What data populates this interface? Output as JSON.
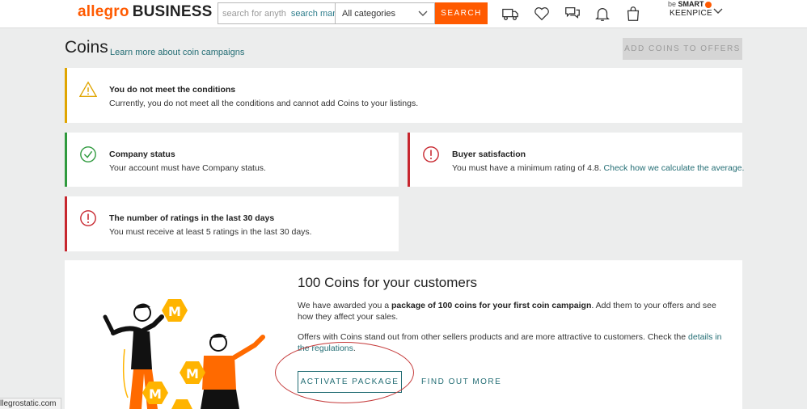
{
  "header": {
    "logo_brand": "allegro",
    "logo_suffix": "BUSINESS",
    "search_placeholder": "search for anyth",
    "search_hint": "search many",
    "category": "All categories",
    "search_button": "SEARCH",
    "account_program_prefix": "be",
    "account_program": "SMART",
    "account_name": "KEENPICE"
  },
  "page": {
    "title": "Coins",
    "learn_link": "Learn more about coin campaigns",
    "add_coins_button": "ADD COINS TO OFFERS"
  },
  "alerts": {
    "warning": {
      "title": "You do not meet the conditions",
      "text": "Currently, you do not meet all the conditions and cannot add Coins to your listings."
    },
    "company": {
      "title": "Company status",
      "text": "Your account must have Company status."
    },
    "buyer": {
      "title": "Buyer satisfaction",
      "text": "You must have a minimum rating of 4.8.",
      "link": "Check how we calculate the average."
    },
    "ratings": {
      "title": "The number of ratings in the last 30 days",
      "text": "You must receive at least 5 ratings in the last 30 days."
    }
  },
  "promo": {
    "title": "100 Coins for your customers",
    "p1_pre": "We have awarded you a ",
    "p1_bold": "package of 100 coins for your first coin campaign",
    "p1_post": ". Add them to your offers and see how they affect your sales.",
    "p2_pre": "Offers with Coins stand out from other sellers products and are more attractive to customers. Check the ",
    "p2_link": "details in the regulations",
    "p2_post": ".",
    "activate_button": "ACTIVATE PACKAGE",
    "find_out_button": "FIND OUT MORE"
  },
  "status_bar": {
    "text": "llegrostatic.com"
  },
  "colors": {
    "brand_orange": "#ff5a00",
    "link_teal": "#236d74",
    "warning_yellow": "#e0a500",
    "success_green": "#2f9a3e",
    "error_red": "#c7262e"
  }
}
